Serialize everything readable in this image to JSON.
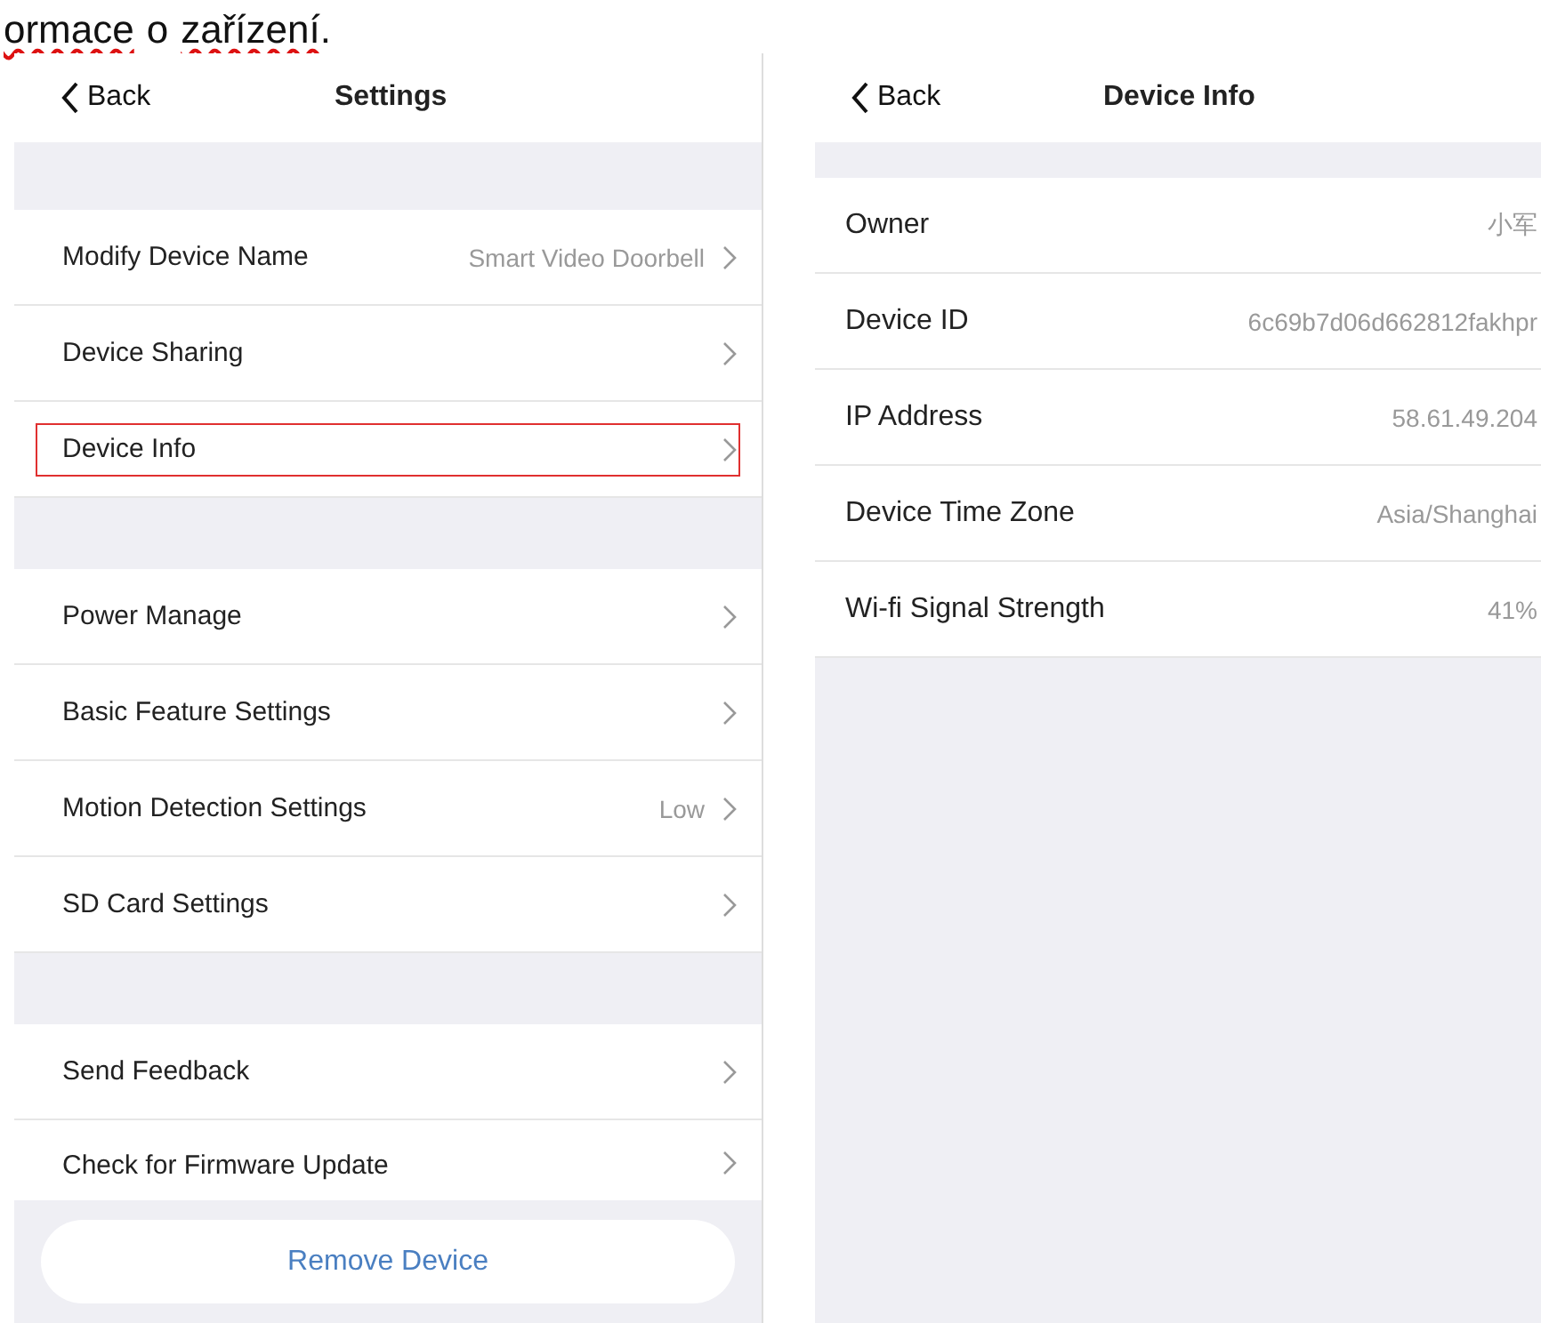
{
  "document_text": [
    {
      "text": "ormace",
      "misspelled": true
    },
    {
      "text": "o",
      "misspelled": false
    },
    {
      "text": "zařízení",
      "misspelled": true
    },
    {
      "text": ".",
      "misspelled": false
    }
  ],
  "settings_screen": {
    "back": "Back",
    "title": "Settings",
    "groups": [
      [
        {
          "label": "Modify Device Name",
          "value": "Smart  Video Doorbell",
          "highlighted": false
        },
        {
          "label": "Device Sharing",
          "highlighted": false
        },
        {
          "label": "Device Info",
          "highlighted": true
        }
      ],
      [
        {
          "label": "Power Manage",
          "highlighted": false
        },
        {
          "label": "Basic Feature Settings",
          "highlighted": false
        },
        {
          "label": "Motion Detection Settings",
          "value": "Low",
          "highlighted": false
        },
        {
          "label": "SD Card Settings",
          "highlighted": false
        }
      ],
      [
        {
          "label": "Send Feedback",
          "highlighted": false
        },
        {
          "label": "Check for Firmware Update",
          "highlighted": false
        }
      ]
    ],
    "remove_button": "Remove Device"
  },
  "device_info_screen": {
    "back": "Back",
    "title": "Device Info",
    "rows": [
      {
        "label": "Owner",
        "value": "小军"
      },
      {
        "label": "Device ID",
        "value": "6c69b7d06d662812fakhpr"
      },
      {
        "label": "IP Address",
        "value": "58.61.49.204"
      },
      {
        "label": "Device Time Zone",
        "value": "Asia/Shanghai"
      },
      {
        "label": "Wi-fi Signal Strength",
        "value": "41%"
      }
    ]
  }
}
